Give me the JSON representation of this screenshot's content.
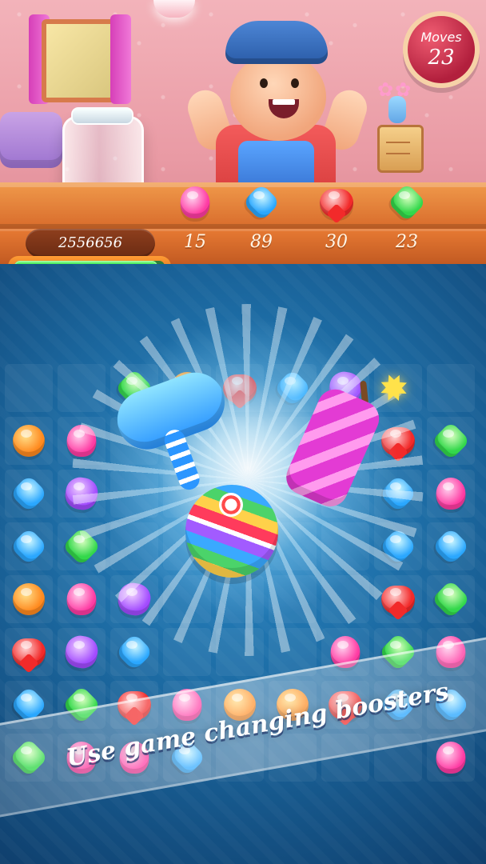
{
  "hud": {
    "moves_label": "Moves",
    "moves_value": "23",
    "score": "2556656",
    "progress": 0.95
  },
  "goals": [
    {
      "icon": "pink-drop-candy-icon",
      "count": "15",
      "color": "#ff3ba3"
    },
    {
      "icon": "blue-square-candy-icon",
      "count": "89",
      "color": "#2aa7ff"
    },
    {
      "icon": "red-heart-candy-icon",
      "count": "30",
      "color": "#f22a2a"
    },
    {
      "icon": "green-diamond-candy-icon",
      "count": "23",
      "color": "#33d84b"
    }
  ],
  "board": {
    "rows": [
      [
        "",
        "",
        "green",
        "orange",
        "red",
        "blue",
        "purple",
        "",
        ""
      ],
      [
        "orange",
        "pink",
        "",
        "",
        "",
        "",
        "",
        "red",
        "green"
      ],
      [
        "blue",
        "purple",
        "",
        "",
        "",
        "",
        "",
        "blue",
        "pink"
      ],
      [
        "blue",
        "green",
        "",
        "",
        "",
        "",
        "",
        "blue",
        "blue"
      ],
      [
        "orange",
        "pink",
        "purple",
        "",
        "",
        "",
        "",
        "red",
        "green"
      ],
      [
        "red",
        "purple",
        "blue",
        "",
        "",
        "",
        "pink",
        "green",
        "pink"
      ],
      [
        "blue",
        "green",
        "red",
        "pink",
        "orange",
        "orange",
        "red",
        "blue",
        "blue"
      ],
      [
        "green",
        "pink",
        "pink",
        "blue",
        "",
        "",
        "",
        "",
        "pink"
      ]
    ]
  },
  "boosters": [
    {
      "name": "hammer-booster-icon"
    },
    {
      "name": "firework-rocket-booster-icon"
    },
    {
      "name": "rainbow-ball-booster-icon"
    }
  ],
  "banner_text": "Use game changing boosters"
}
